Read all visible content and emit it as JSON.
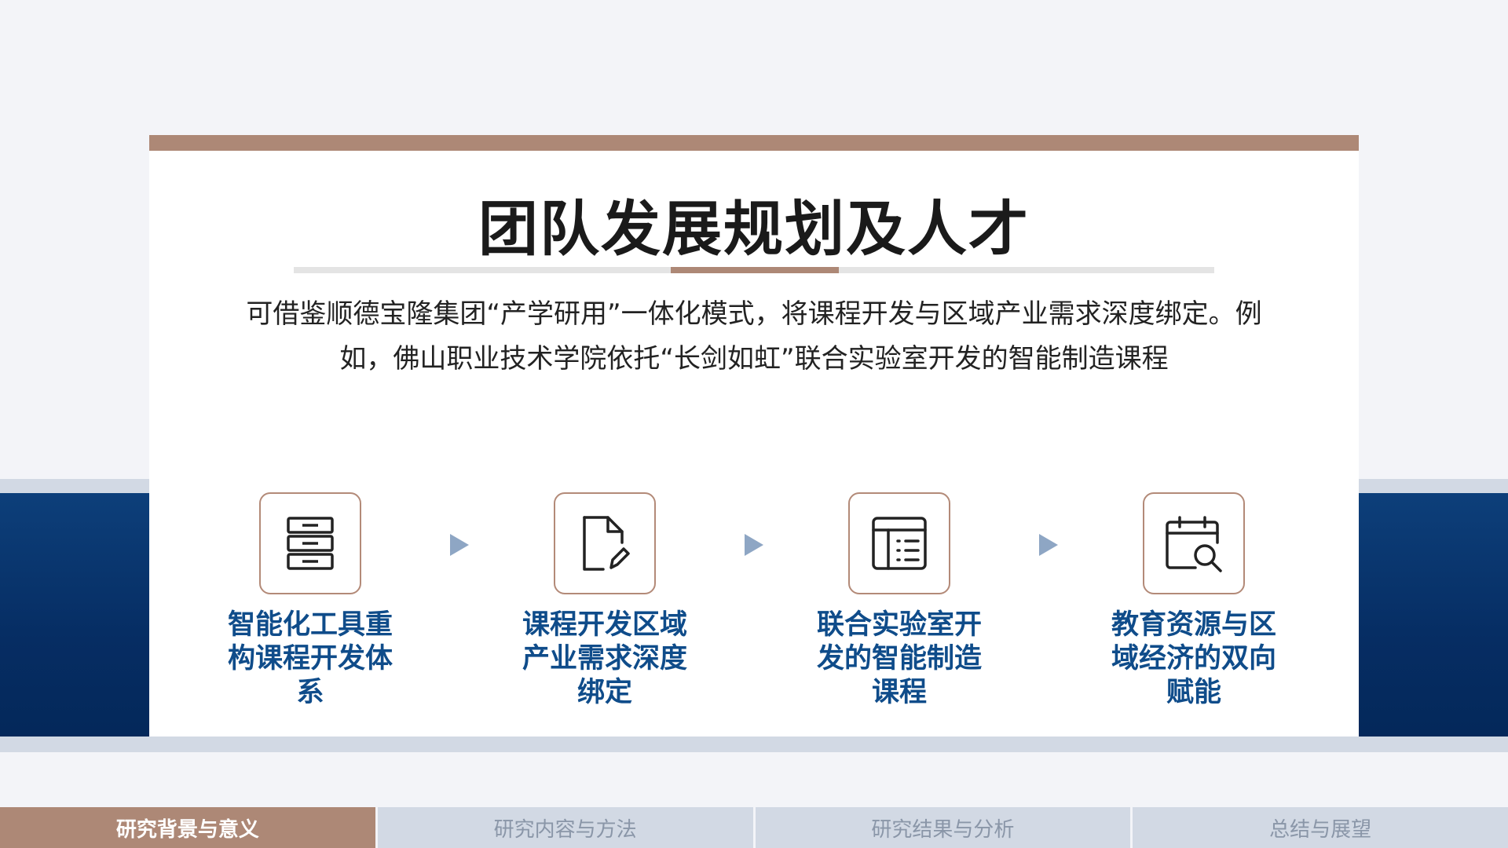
{
  "slide": {
    "title": "团队发展规划及人才",
    "description": "可借鉴顺德宝隆集团“产学研用”一体化模式，将课程开发与区域产业需求深度绑定。例如，佛山职业技术学院依托“长剑如虹”联合实验室开发的智能制造课程",
    "steps": [
      {
        "label": "智能化工具重构课程开发体系",
        "icon": "cabinet-icon"
      },
      {
        "label": "课程开发区域产业需求深度绑定",
        "icon": "document-edit-icon"
      },
      {
        "label": "联合实验室开发的智能制造课程",
        "icon": "table-list-icon"
      },
      {
        "label": "教育资源与区域经济的双向赋能",
        "icon": "calendar-search-icon"
      }
    ]
  },
  "nav": {
    "items": [
      {
        "label": "研究背景与意义",
        "active": true
      },
      {
        "label": "研究内容与方法",
        "active": false
      },
      {
        "label": "研究结果与分析",
        "active": false
      },
      {
        "label": "总结与展望",
        "active": false
      }
    ]
  },
  "colors": {
    "accent": "#ad8876",
    "band": "#062d63",
    "step_text": "#0f4c8a",
    "nav_inactive": "#d2d9e4"
  }
}
